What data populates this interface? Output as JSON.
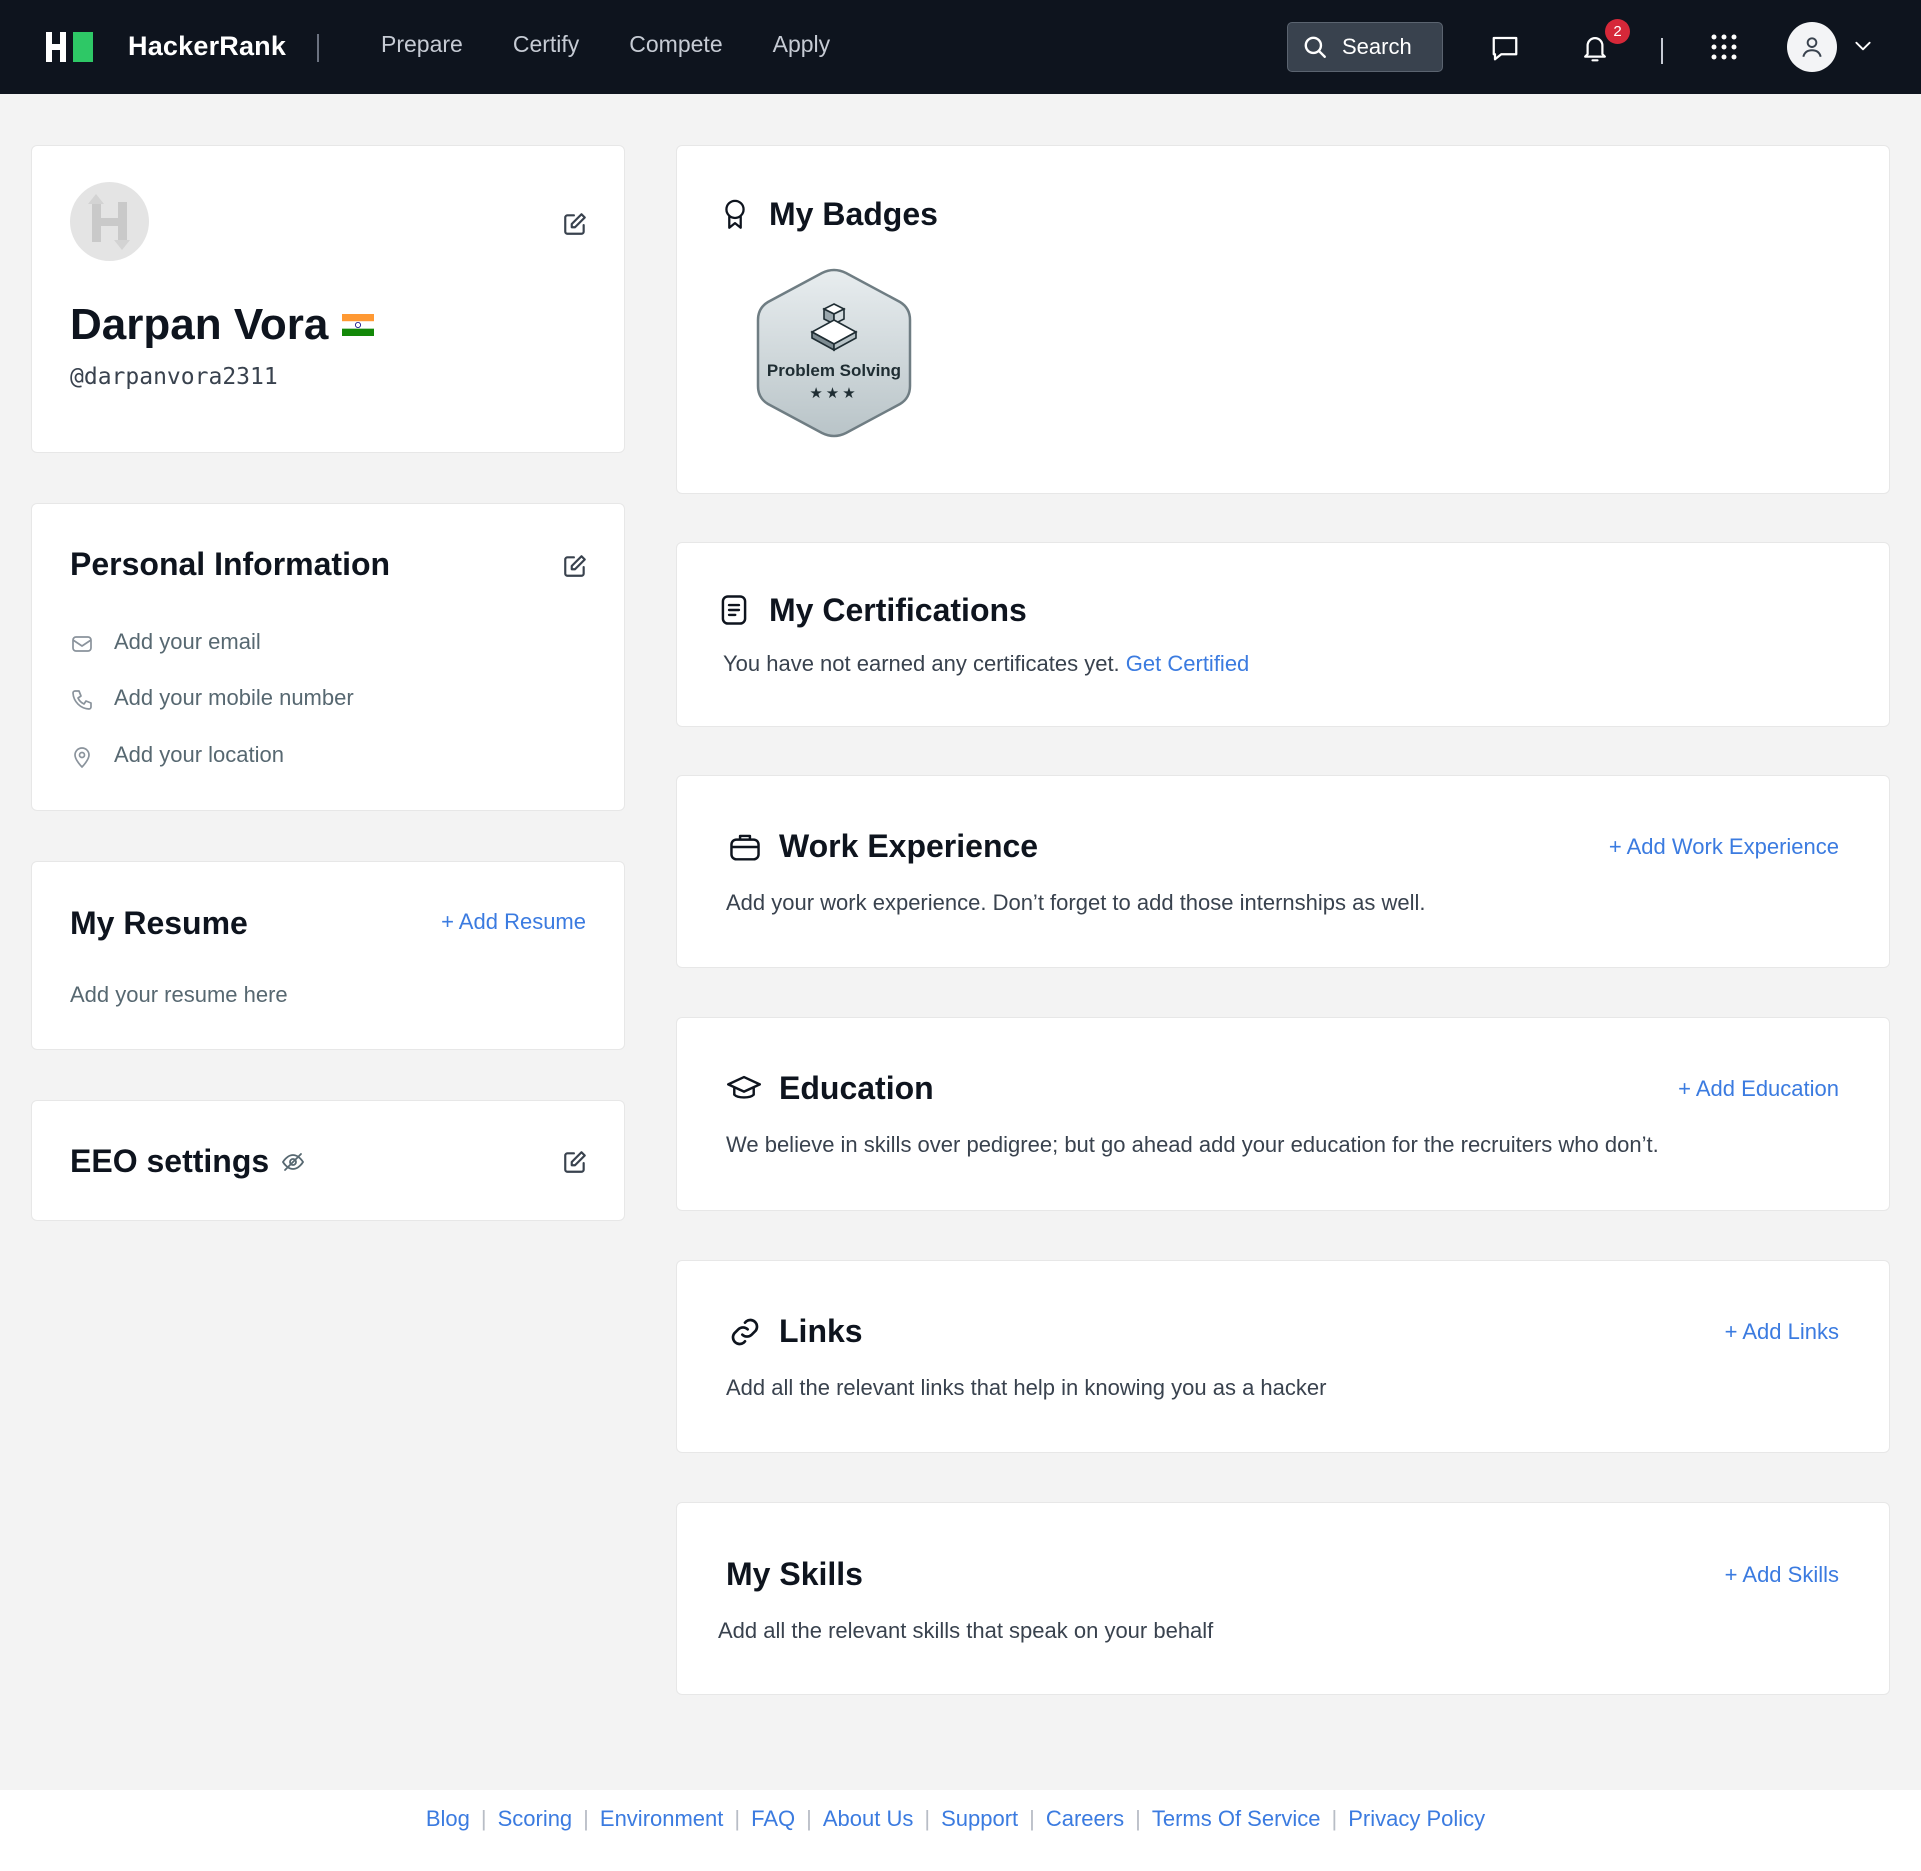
{
  "header": {
    "brand": "HackerRank",
    "nav": [
      "Prepare",
      "Certify",
      "Compete",
      "Apply"
    ],
    "search_label": "Search",
    "notification_count": "2",
    "icons": [
      "search-icon",
      "chat-icon",
      "bell-icon",
      "apps-grid-icon",
      "user-icon",
      "chevron-down-icon"
    ]
  },
  "profile": {
    "name": "Darpan Vora",
    "username": "@darpanvora2311",
    "country_flag": "india-flag"
  },
  "personal_info": {
    "title": "Personal Information",
    "email": "Add your email",
    "mobile": "Add your mobile number",
    "location": "Add your location"
  },
  "resume": {
    "title": "My Resume",
    "add_label": "+ Add Resume",
    "placeholder": "Add your resume here"
  },
  "eeo": {
    "title": "EEO settings"
  },
  "badges": {
    "title": "My Badges",
    "items": [
      {
        "name": "Problem Solving",
        "stars": "★★★"
      }
    ]
  },
  "certifications": {
    "title": "My Certifications",
    "text": "You have not earned any certificates yet.",
    "link": "Get Certified"
  },
  "work": {
    "title": "Work Experience",
    "add_label": "+ Add Work Experience",
    "text": "Add your work experience. Don’t forget to add those internships as well."
  },
  "education": {
    "title": "Education",
    "add_label": "+ Add Education",
    "text": "We believe in skills over pedigree; but go ahead add your education for the recruiters who don’t."
  },
  "links": {
    "title": "Links",
    "add_label": "+ Add Links",
    "text": "Add all the relevant links that help in knowing you as a hacker"
  },
  "skills": {
    "title": "My Skills",
    "add_label": "+ Add Skills",
    "text": "Add all the relevant skills that speak on your behalf"
  },
  "footer": {
    "links": [
      "Blog",
      "Scoring",
      "Environment",
      "FAQ",
      "About Us",
      "Support",
      "Careers",
      "Terms Of Service",
      "Privacy Policy"
    ]
  },
  "colors": {
    "header_bg": "#0e141e",
    "brand_green": "#2ec866",
    "link_blue": "#3b7be0",
    "notification_red": "#d62839"
  }
}
